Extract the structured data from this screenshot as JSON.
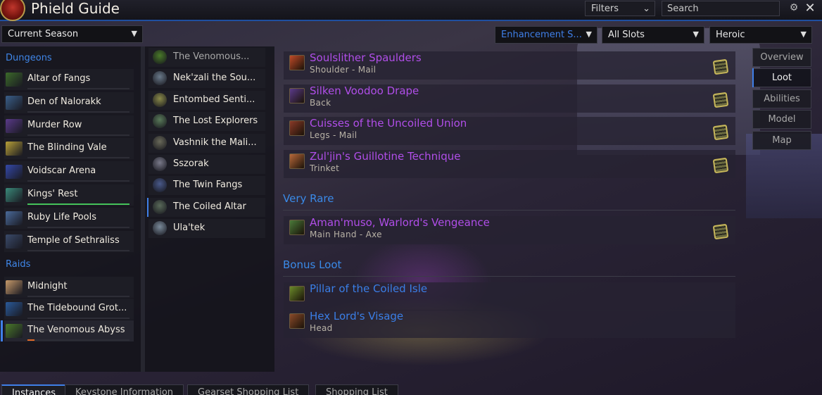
{
  "app": {
    "title": "Phield Guide"
  },
  "toolbar": {
    "filters_label": "Filters",
    "search_placeholder": "Search"
  },
  "dropdowns": {
    "season": "Current Season",
    "spec": "Enhancement S...",
    "slots": "All Slots",
    "difficulty": "Heroic"
  },
  "sections": {
    "dungeons": "Dungeons",
    "raids": "Raids"
  },
  "dungeons": [
    {
      "name": "Altar of Fangs",
      "icon": "altar-of-fangs-icon",
      "color": "#3c6a2a",
      "progress_color": "#2d2d36",
      "progress": 0
    },
    {
      "name": "Den of Nalorakk",
      "icon": "den-of-nalorakk-icon",
      "color": "#3a5f8a",
      "progress_color": "#2d2d36",
      "progress": 0
    },
    {
      "name": "Murder Row",
      "icon": "murder-row-icon",
      "color": "#5a3a8a",
      "progress_color": "#2d2d36",
      "progress": 0
    },
    {
      "name": "The Blinding Vale",
      "icon": "blinding-vale-icon",
      "color": "#b8a038",
      "progress_color": "#2d2d36",
      "progress": 0
    },
    {
      "name": "Voidscar Arena",
      "icon": "voidscar-arena-icon",
      "color": "#3448a8",
      "progress_color": "#2d2d36",
      "progress": 0
    },
    {
      "name": "Kings' Rest",
      "icon": "kings-rest-icon",
      "color": "#3a8a7a",
      "progress_color": "#44c25a",
      "progress": 1
    },
    {
      "name": "Ruby Life Pools",
      "icon": "ruby-life-pools-icon",
      "color": "#4a6a9a",
      "progress_color": "#2d2d36",
      "progress": 0
    },
    {
      "name": "Temple of Sethraliss",
      "icon": "temple-of-sethraliss-icon",
      "color": "#3a4a6a",
      "progress_color": "#2d2d36",
      "progress": 0
    }
  ],
  "raids": [
    {
      "name": "Midnight",
      "icon": "midnight-icon",
      "color": "#c89a6a",
      "progress_color": "#2d2d36",
      "progress": 0,
      "selected": false
    },
    {
      "name": "The Tidebound Grot...",
      "icon": "tidebound-grotto-icon",
      "color": "#2a5a9a",
      "progress_color": "#2d2d36",
      "progress": 0,
      "selected": false
    },
    {
      "name": "The Venomous Abyss",
      "icon": "venomous-abyss-icon",
      "color": "#4a7a2a",
      "progress_color": "#e06a28",
      "progress": 0.07,
      "selected": true
    }
  ],
  "bosses": [
    {
      "name": "The Venomous...",
      "icon": "venomous-boss-icon",
      "color": "#4a7a2a",
      "dim": true,
      "selected": false
    },
    {
      "name": "Nek'zali the Sou...",
      "icon": "nekzali-icon",
      "color": "#6a7a8a",
      "dim": false,
      "selected": false
    },
    {
      "name": "Entombed Senti...",
      "icon": "entombed-sentinel-icon",
      "color": "#8a8a4a",
      "dim": false,
      "selected": false
    },
    {
      "name": "The Lost Explorers",
      "icon": "lost-explorers-icon",
      "color": "#5a7a5a",
      "dim": false,
      "selected": false
    },
    {
      "name": "Vashnik the Mali...",
      "icon": "vashnik-icon",
      "color": "#6a6a5a",
      "dim": false,
      "selected": false
    },
    {
      "name": "Sszorak",
      "icon": "sszorak-icon",
      "color": "#7a7a8a",
      "dim": false,
      "selected": false
    },
    {
      "name": "The Twin Fangs",
      "icon": "twin-fangs-icon",
      "color": "#4a5a8a",
      "dim": false,
      "selected": false
    },
    {
      "name": "The Coiled Altar",
      "icon": "coiled-altar-icon",
      "color": "#5a6a5a",
      "dim": false,
      "selected": true
    },
    {
      "name": "Ula'tek",
      "icon": "ulatek-icon",
      "color": "#7a8a9a",
      "dim": false,
      "selected": false
    }
  ],
  "loot": {
    "items": [
      {
        "name": "Soulslither Spaulders",
        "sub": "Shoulder - Mail",
        "icon": "shoulder-icon",
        "color": "#b04ee8",
        "icon_color": "#c04a28"
      },
      {
        "name": "Silken Voodoo Drape",
        "sub": "Back",
        "icon": "cloak-icon",
        "color": "#b04ee8",
        "icon_color": "#5a3a8a"
      },
      {
        "name": "Cuisses of the Uncoiled Union",
        "sub": "Legs - Mail",
        "icon": "legs-icon",
        "color": "#b04ee8",
        "icon_color": "#8a3a28"
      },
      {
        "name": "Zul'jin's Guillotine Technique",
        "sub": "Trinket",
        "icon": "trinket-icon",
        "color": "#b04ee8",
        "icon_color": "#b8683a"
      }
    ],
    "very_rare_title": "Very Rare",
    "very_rare": [
      {
        "name": "Aman'muso, Warlord's Vengeance",
        "sub": "Main Hand - Axe",
        "icon": "axe-icon",
        "color": "#b04ee8",
        "icon_color": "#4a7a3a"
      }
    ],
    "bonus_title": "Bonus Loot",
    "bonus": [
      {
        "name": "Pillar of the Coiled Isle",
        "sub": "",
        "icon": "pillar-icon",
        "color": "#3a7ee6",
        "icon_color": "#6a8a2a"
      },
      {
        "name": "Hex Lord's Visage",
        "sub": "Head",
        "icon": "head-icon",
        "color": "#3a7ee6",
        "icon_color": "#8a4a2a"
      }
    ]
  },
  "side_tabs": [
    {
      "label": "Overview",
      "active": false
    },
    {
      "label": "Loot",
      "active": true
    },
    {
      "label": "Abilities",
      "active": false
    },
    {
      "label": "Model",
      "active": false
    },
    {
      "label": "Map",
      "active": false
    }
  ],
  "bottom_tabs": [
    {
      "label": "Instances",
      "active": true
    },
    {
      "label": "Keystone Information",
      "active": false
    },
    {
      "label": "Gearset Shopping List",
      "active": false
    },
    {
      "label": "Shopping List",
      "active": false
    }
  ]
}
